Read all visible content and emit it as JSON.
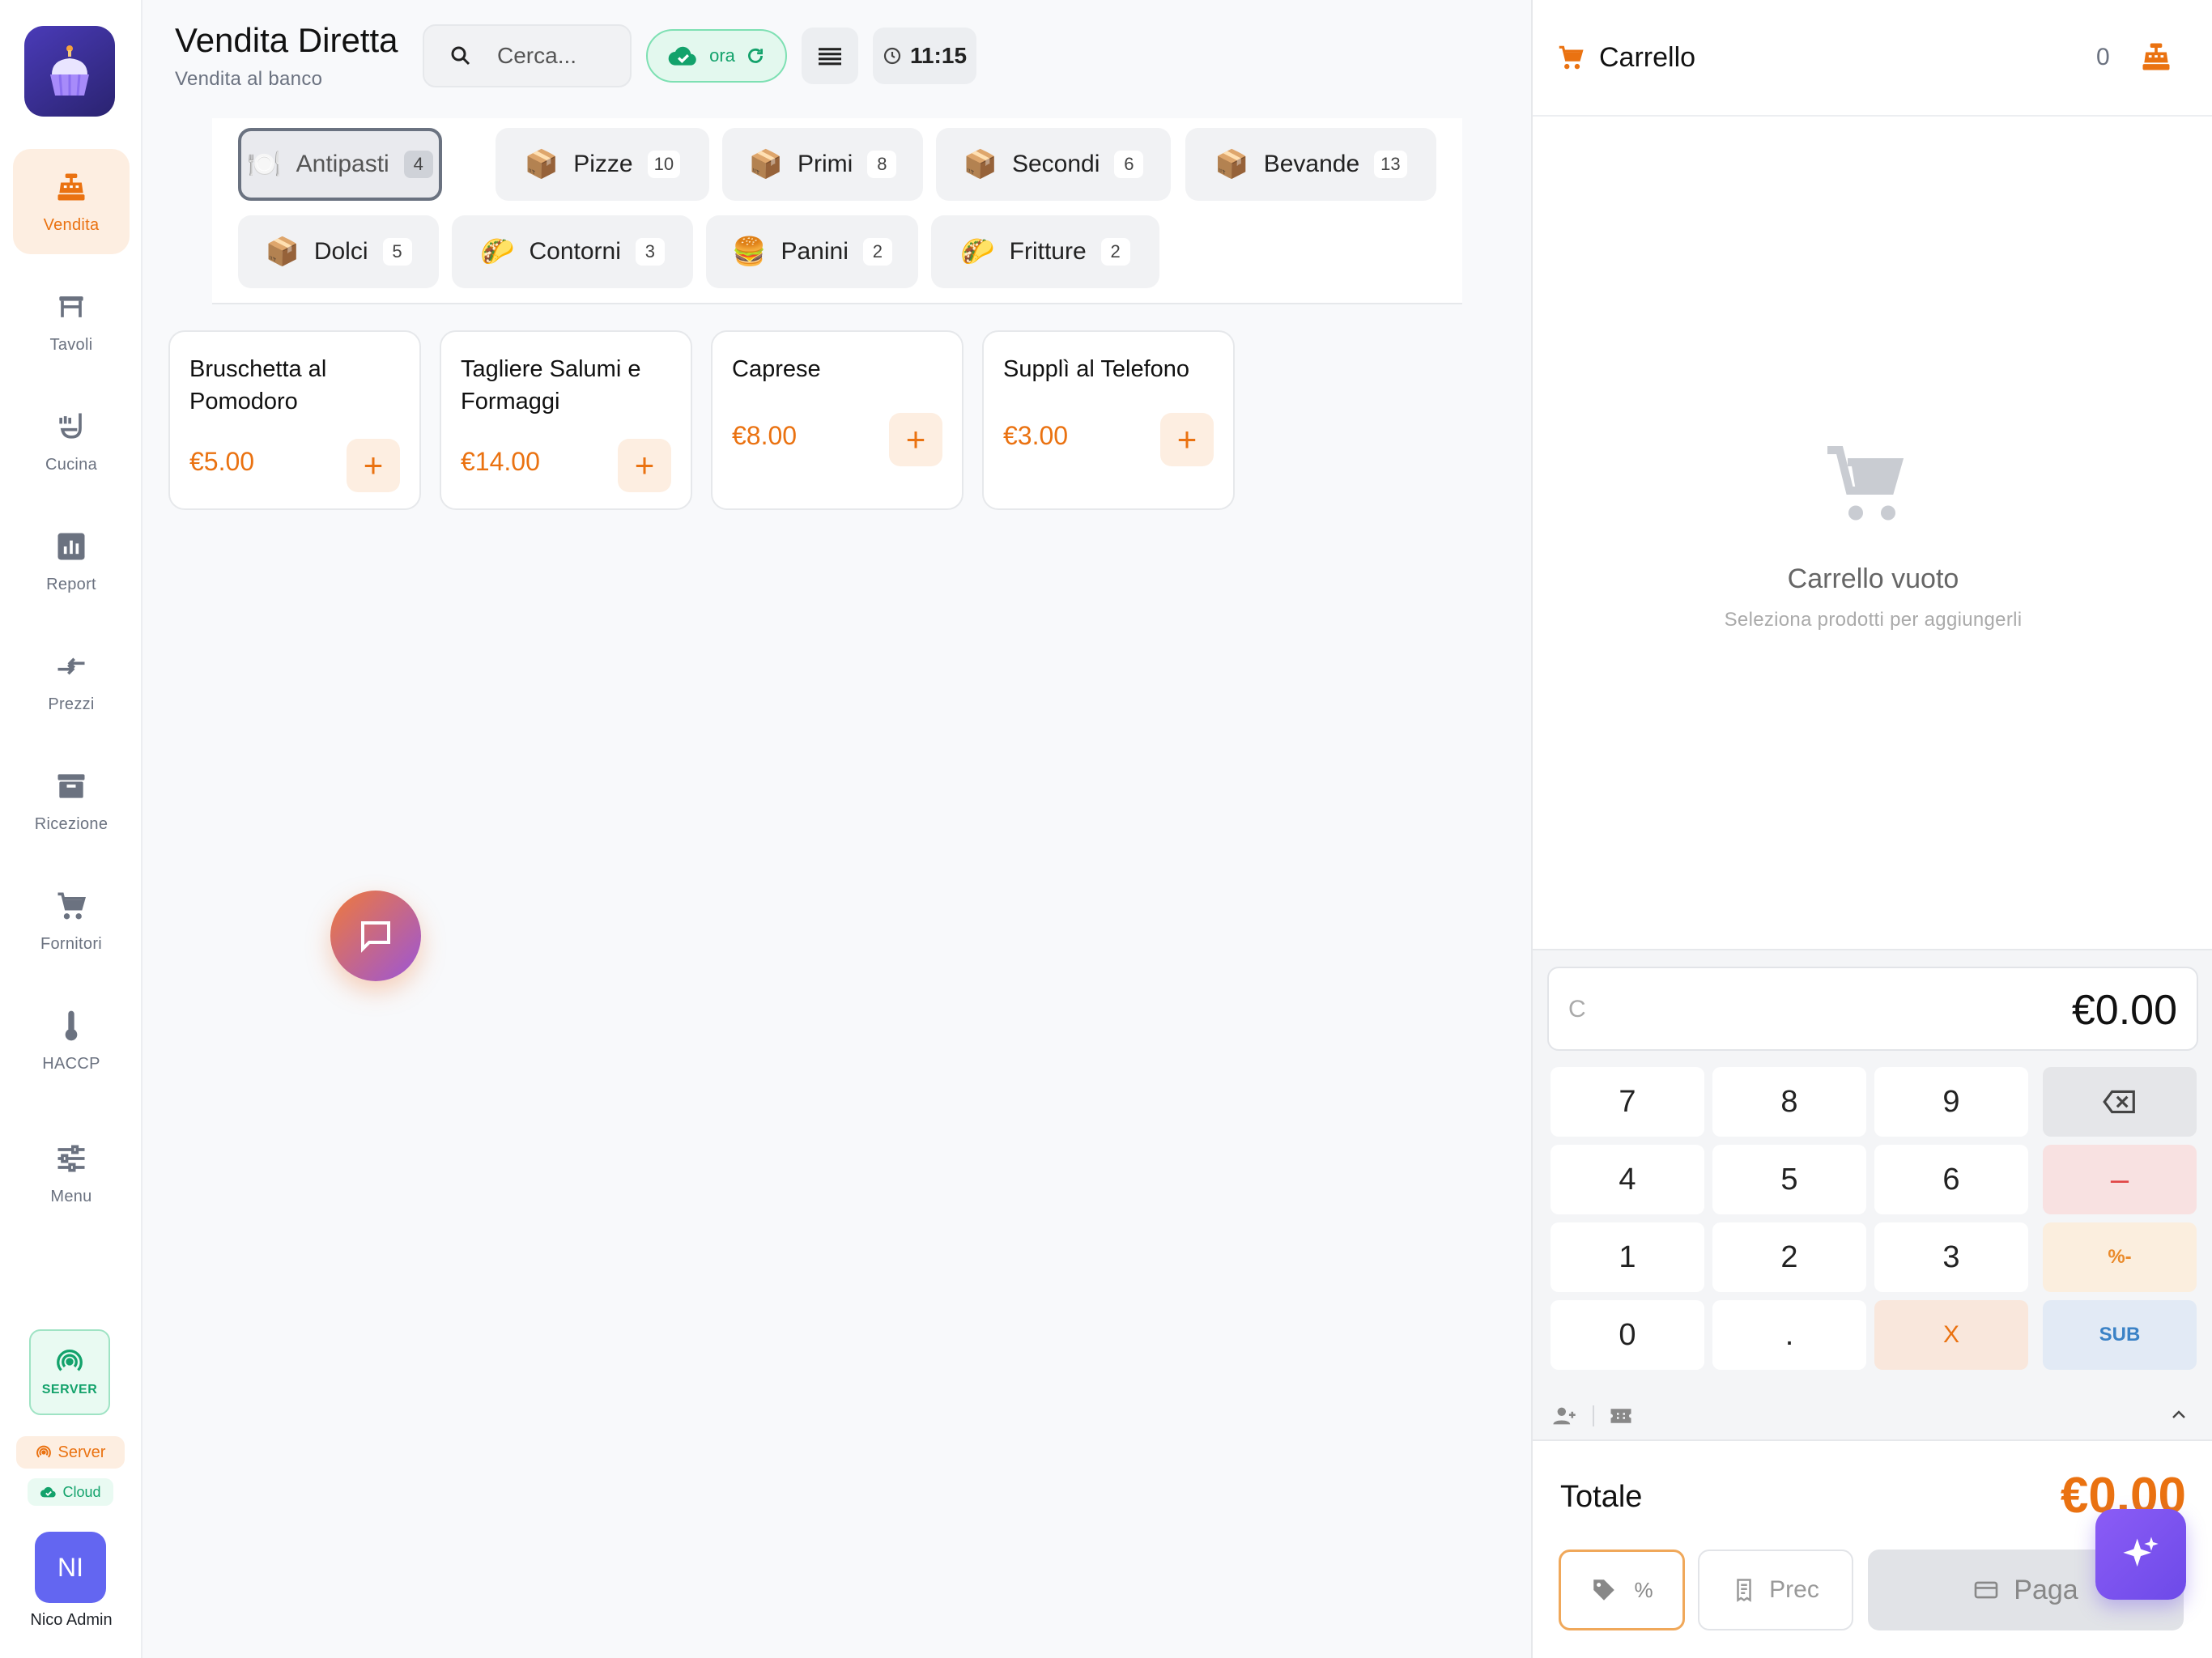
{
  "sidebar": {
    "nav": [
      {
        "label": "Vendita",
        "icon": "cash-register-icon",
        "active": true
      },
      {
        "label": "Tavoli",
        "icon": "table-icon"
      },
      {
        "label": "Cucina",
        "icon": "ladle-icon"
      },
      {
        "label": "Report",
        "icon": "bar-chart-icon"
      },
      {
        "label": "Prezzi",
        "icon": "compare-arrows-icon"
      },
      {
        "label": "Ricezione",
        "icon": "archive-box-icon"
      },
      {
        "label": "Fornitori",
        "icon": "cart-icon"
      },
      {
        "label": "HACCP",
        "icon": "thermometer-icon"
      },
      {
        "label": "Menu",
        "icon": "sliders-icon"
      }
    ],
    "server_box_label": "SERVER",
    "server_pill": "Server",
    "cloud_pill": "Cloud",
    "avatar_initials": "NI",
    "user_name": "Nico Admin"
  },
  "header": {
    "title": "Vendita Diretta",
    "subtitle": "Vendita al banco",
    "search_placeholder": "Cerca...",
    "sync_label": "ora",
    "time": "11:15"
  },
  "categories": [
    {
      "name": "Antipasti",
      "count": "4",
      "emoji": "🍽️",
      "active": true
    },
    {
      "name": "Pizze",
      "count": "10",
      "emoji": "📦"
    },
    {
      "name": "Primi",
      "count": "8",
      "emoji": "📦"
    },
    {
      "name": "Secondi",
      "count": "6",
      "emoji": "📦"
    },
    {
      "name": "Bevande",
      "count": "13",
      "emoji": "📦"
    },
    {
      "name": "Dolci",
      "count": "5",
      "emoji": "📦"
    },
    {
      "name": "Contorni",
      "count": "3",
      "emoji": "🌮"
    },
    {
      "name": "Panini",
      "count": "2",
      "emoji": "🍔"
    },
    {
      "name": "Fritture",
      "count": "2",
      "emoji": "🌮"
    }
  ],
  "products": [
    {
      "name": "Bruschetta al Pomodoro",
      "price": "€5.00"
    },
    {
      "name": "Tagliere Salumi e Formaggi",
      "price": "€14.00"
    },
    {
      "name": "Caprese",
      "price": "€8.00"
    },
    {
      "name": "Supplì al Telefono",
      "price": "€3.00"
    }
  ],
  "cart": {
    "title": "Carrello",
    "count": "0",
    "empty_title": "Carrello vuoto",
    "empty_sub": "Seleziona prodotti per aggiungerli",
    "display_clear": "C",
    "display_value": "€0.00",
    "keys": [
      "7",
      "8",
      "9",
      "4",
      "5",
      "6",
      "1",
      "2",
      "3",
      "0",
      "."
    ],
    "key_minus": "–",
    "key_pct": "%-",
    "key_x": "X",
    "key_sub": "SUB",
    "total_label": "Totale",
    "total_value": "€0.00",
    "discount_label": "%",
    "prec_label": "Prec",
    "pay_label": "Paga"
  },
  "colors": {
    "accent": "#ea7211",
    "success": "#13a26b",
    "brand": "#4a3bb8"
  }
}
